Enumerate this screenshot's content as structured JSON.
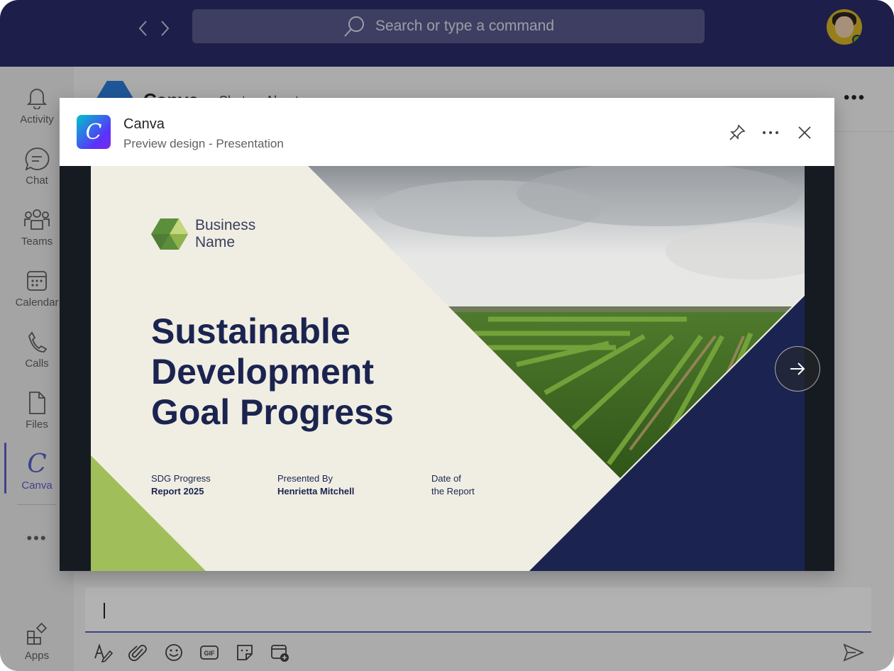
{
  "header": {
    "search_placeholder": "Search or type a command"
  },
  "rail": {
    "items": [
      {
        "label": "Activity",
        "icon": "bell-icon"
      },
      {
        "label": "Chat",
        "icon": "chat-icon"
      },
      {
        "label": "Teams",
        "icon": "teams-icon"
      },
      {
        "label": "Calendar",
        "icon": "calendar-icon"
      },
      {
        "label": "Calls",
        "icon": "phone-icon"
      },
      {
        "label": "Files",
        "icon": "file-icon"
      },
      {
        "label": "Canva",
        "icon": "canva-icon"
      }
    ],
    "more": "•••",
    "apps_label": "Apps"
  },
  "chat_header": {
    "title": "Canva",
    "tabs": [
      "Chat",
      "About"
    ]
  },
  "modal": {
    "app_letter": "C",
    "app_name": "Canva",
    "subtitle": "Preview design - Presentation"
  },
  "slide": {
    "business_line1": "Business",
    "business_line2": "Name",
    "headline": [
      "Sustainable",
      "Development",
      "Goal Progress"
    ],
    "meta": [
      {
        "line1": "SDG Progress",
        "line2": "Report 2025",
        "bold_second": true
      },
      {
        "line1": "Presented By",
        "line2": "Henrietta Mitchell",
        "bold_second": true
      },
      {
        "line1": "Date of",
        "line2": "the Report",
        "bold_second": false
      }
    ]
  },
  "colors": {
    "topbar": "#2b2b6b",
    "accent": "#5b5fc7",
    "slide_navy": "#1b2450",
    "slide_green": "#a0bf5a",
    "slide_bg": "#f0eee3"
  }
}
